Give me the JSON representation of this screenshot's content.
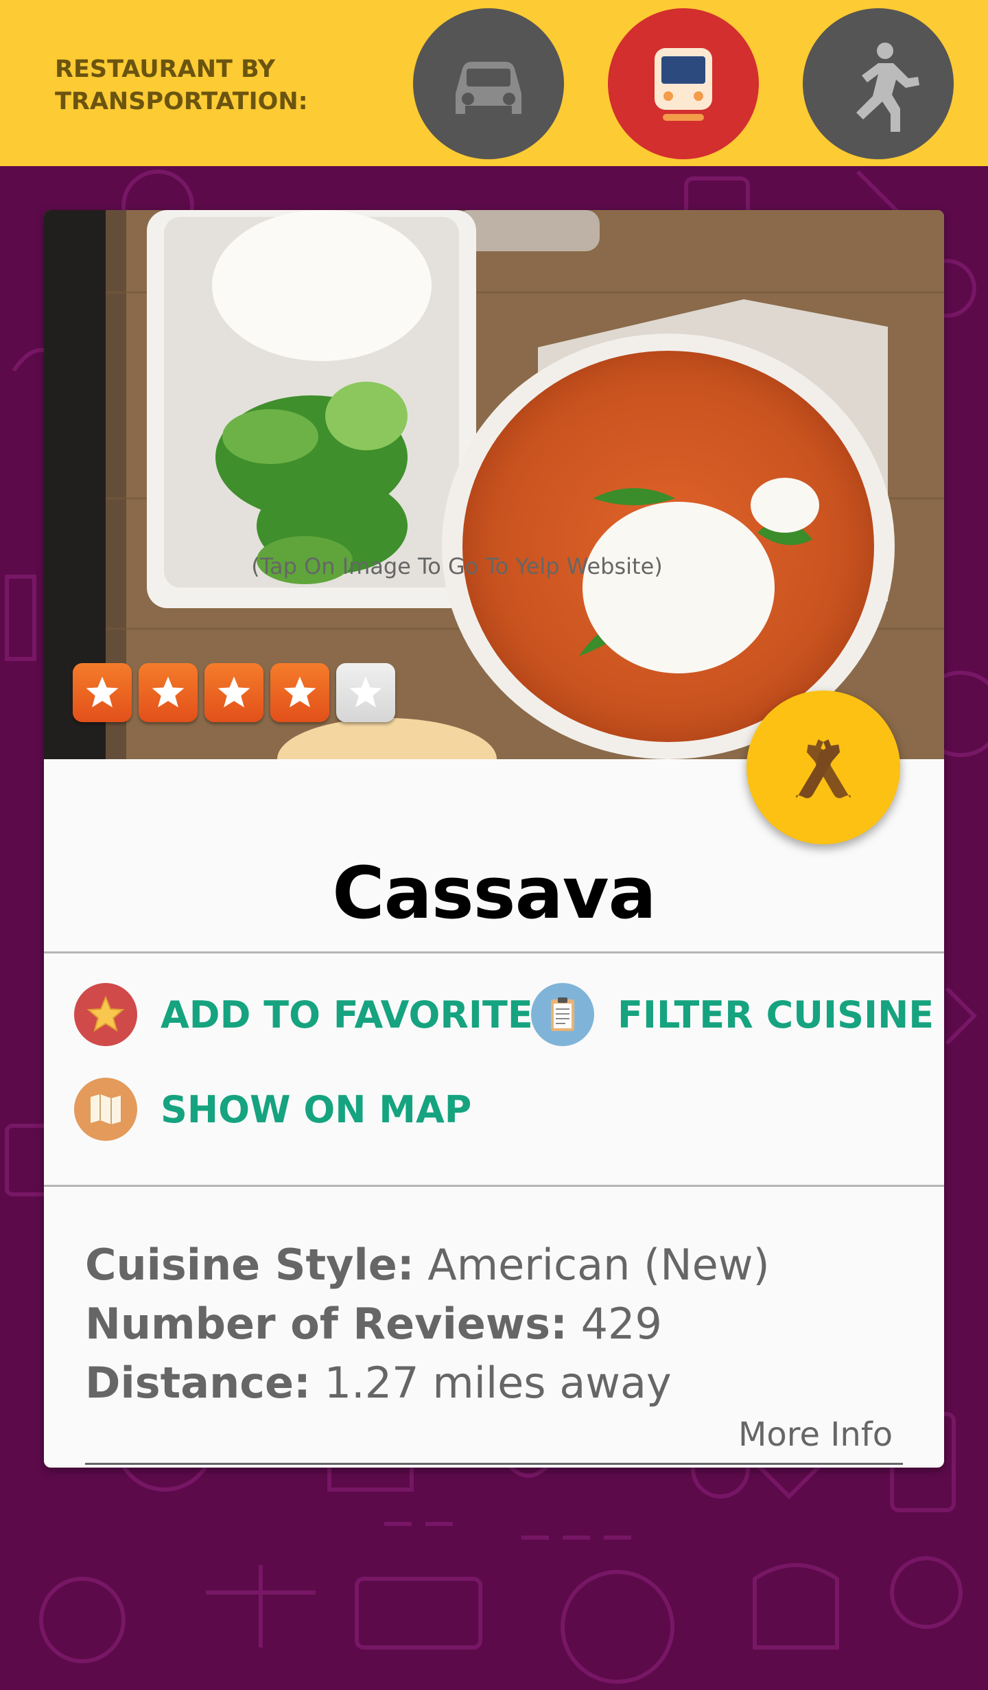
{
  "header": {
    "label": "RESTAURANT BY\nTRANSPORTATION:",
    "modes": [
      {
        "name": "car",
        "icon": "car-icon",
        "color": "#555555",
        "selected": false
      },
      {
        "name": "transit",
        "icon": "train-icon",
        "color": "#d32f2f",
        "selected": true
      },
      {
        "name": "walk",
        "icon": "walk-icon",
        "color": "#555555",
        "selected": false
      }
    ]
  },
  "restaurant": {
    "photo_hint": "(Tap On Image To Go To Yelp Website)",
    "rating": 4,
    "rating_max": 5,
    "name": "Cassava",
    "fab_icon": "bottles-icon"
  },
  "actions": {
    "favorites": {
      "label": "ADD TO FAVORITES",
      "icon": "star-icon"
    },
    "filter": {
      "label": "FILTER CUISINE",
      "icon": "clipboard-icon"
    },
    "map": {
      "label": "SHOW ON MAP",
      "icon": "map-icon"
    }
  },
  "details": {
    "cuisine_label": "Cuisine Style:",
    "cuisine_value": "American (New)",
    "reviews_label": "Number of Reviews:",
    "reviews_value": "429",
    "distance_label": "Distance:",
    "distance_value": "1.27 miles away",
    "more_info": "More Info"
  },
  "colors": {
    "topbar": "#fdcb33",
    "background": "#5c0a4a",
    "accent_text": "#16a37f",
    "fab": "#fdc113"
  }
}
